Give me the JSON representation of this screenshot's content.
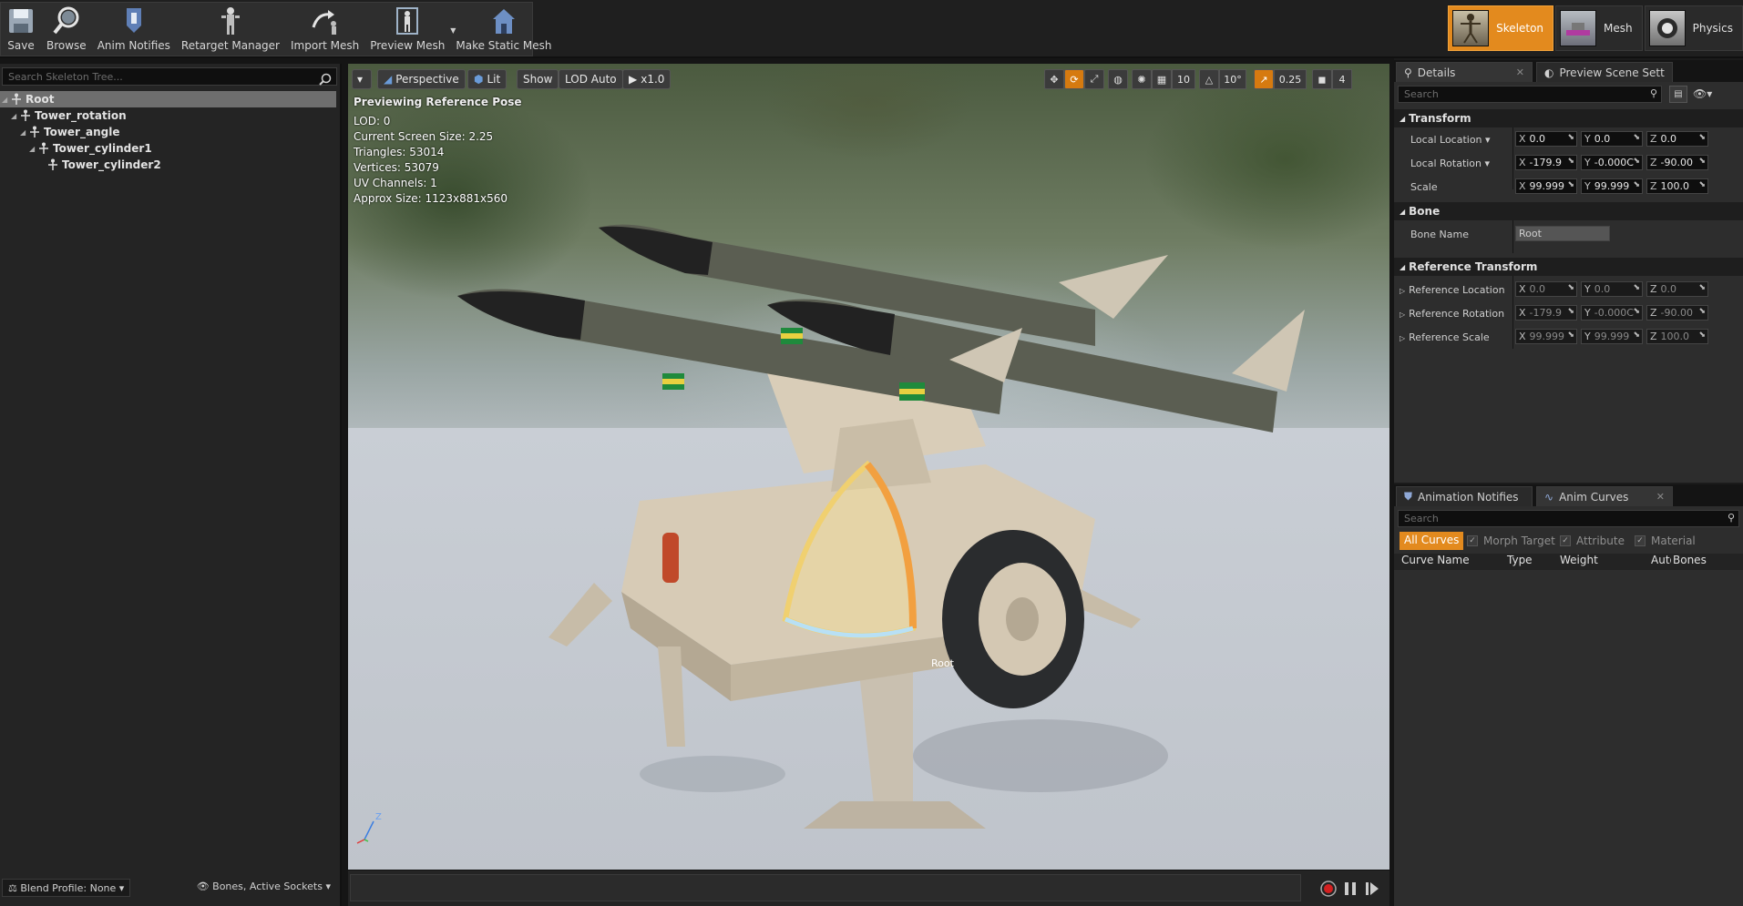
{
  "toolbar": {
    "items": [
      {
        "label": "Save",
        "icon": "save-icon"
      },
      {
        "label": "Browse",
        "icon": "browse-icon"
      },
      {
        "label": "Anim Notifies",
        "icon": "anim-notifies-icon"
      },
      {
        "label": "Retarget Manager",
        "icon": "retarget-manager-icon"
      },
      {
        "label": "Import Mesh",
        "icon": "import-mesh-icon"
      },
      {
        "label": "Preview Mesh",
        "icon": "preview-mesh-icon"
      },
      {
        "label": "Make Static Mesh",
        "icon": "make-static-mesh-icon"
      }
    ],
    "modes": [
      {
        "label": "Skeleton",
        "active": true
      },
      {
        "label": "Mesh",
        "active": false
      },
      {
        "label": "Physics",
        "active": false
      }
    ]
  },
  "skeleton_tree": {
    "search_placeholder": "Search Skeleton Tree...",
    "bones": [
      {
        "name": "Root",
        "depth": 0,
        "selected": true
      },
      {
        "name": "Tower_rotation",
        "depth": 1,
        "selected": false
      },
      {
        "name": "Tower_angle",
        "depth": 2,
        "selected": false
      },
      {
        "name": "Tower_cylinder1",
        "depth": 3,
        "selected": false
      },
      {
        "name": "Tower_cylinder2",
        "depth": 4,
        "selected": false
      }
    ],
    "blend_profile": "Blend Profile: None",
    "bones_filter": "Bones, Active Sockets"
  },
  "viewport": {
    "perspective": "Perspective",
    "lit": "Lit",
    "show": "Show",
    "lod": "LOD Auto",
    "speed": "x1.0",
    "grid_snap": "10",
    "rot_snap": "10°",
    "scale_snap": "0.25",
    "camera_speed": "4",
    "previewing": "Previewing Reference Pose",
    "stats": [
      "LOD: 0",
      "Current Screen Size: 2.25",
      "Triangles: 53014",
      "Vertices: 53079",
      "UV Channels: 1",
      "Approx Size: 1123x881x560"
    ],
    "bone_label": "Root",
    "axis_z": "Z"
  },
  "details": {
    "tabs": [
      "Details",
      "Preview Scene Sett"
    ],
    "search_placeholder": "Search",
    "transform": {
      "title": "Transform",
      "local_location": {
        "label": "Local Location",
        "x": "0.0",
        "y": "0.0",
        "z": "0.0"
      },
      "local_rotation": {
        "label": "Local Rotation",
        "x": "-179.9 ",
        "y": "-0.000C",
        "z": "-90.00"
      },
      "scale": {
        "label": "Scale",
        "x": "99.999",
        "y": "99.999",
        "z": "100.0"
      }
    },
    "bone": {
      "title": "Bone",
      "name_label": "Bone Name",
      "name_value": "Root"
    },
    "reference": {
      "title": "Reference Transform",
      "location": {
        "label": "Reference Location",
        "x": "0.0",
        "y": "0.0",
        "z": "0.0"
      },
      "rotation": {
        "label": "Reference Rotation",
        "x": "-179.9",
        "y": "-0.000C",
        "z": "-90.00"
      },
      "scale": {
        "label": "Reference Scale",
        "x": "99.999",
        "y": "99.999",
        "z": "100.0"
      }
    }
  },
  "curves": {
    "tabs": [
      "Animation Notifies",
      "Anim Curves"
    ],
    "search_placeholder": "Search",
    "filters": {
      "all": "All Curves",
      "morph": "Morph Target",
      "attribute": "Attribute",
      "material": "Material"
    },
    "columns": [
      "Curve Name",
      "Type",
      "Weight",
      "Auto",
      "Bones"
    ]
  },
  "colors": {
    "accent": "#e38a1e",
    "panel": "#2d2d2d",
    "background": "#151515"
  }
}
